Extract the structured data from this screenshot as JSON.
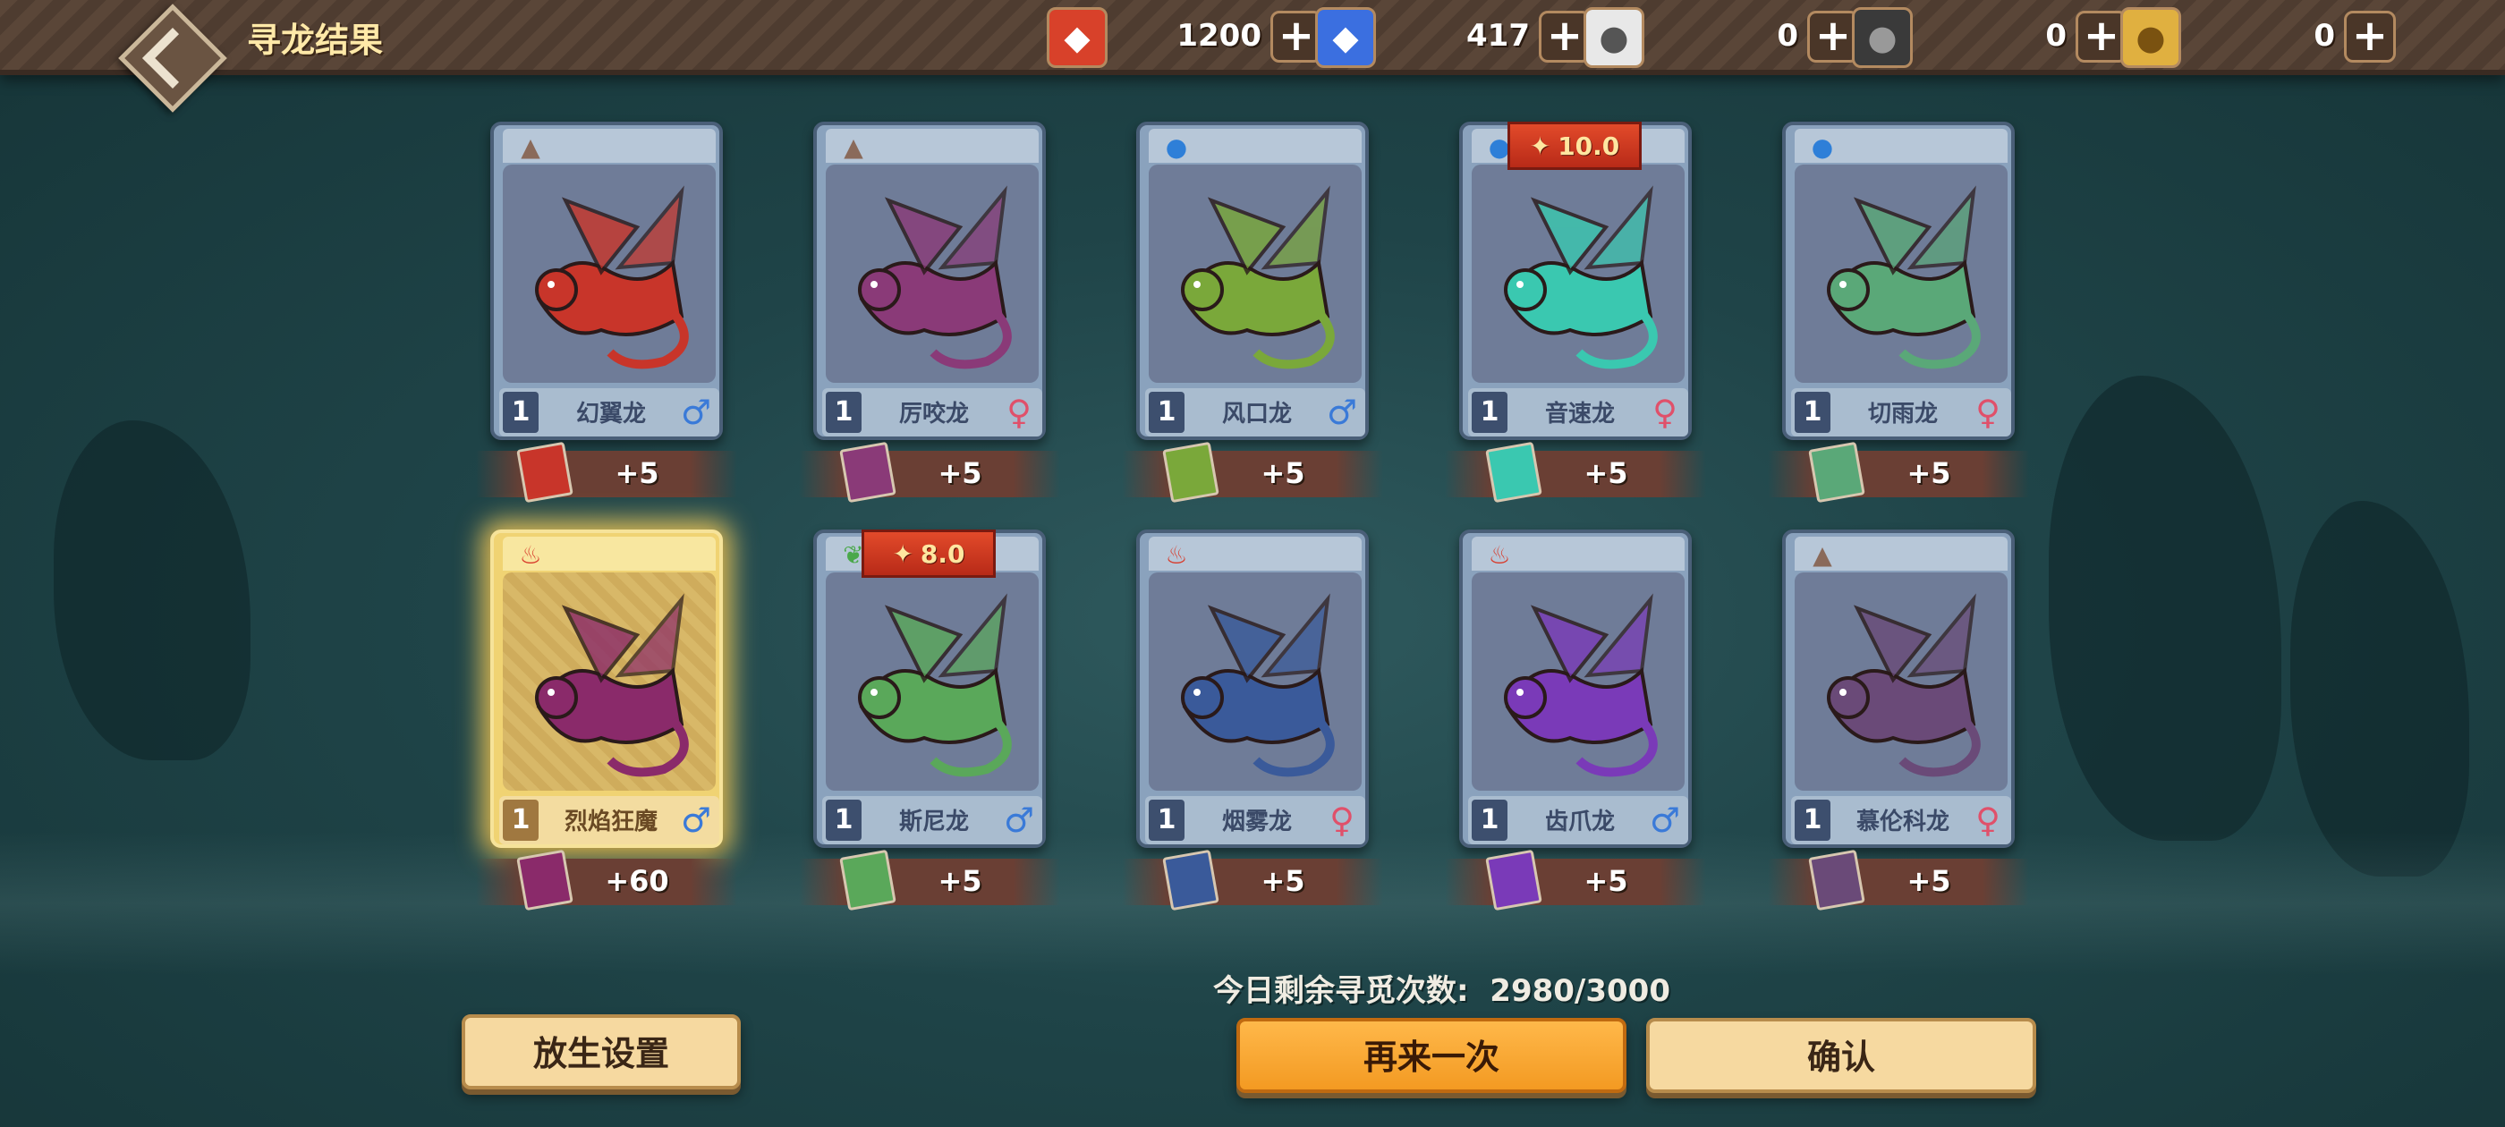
{
  "header": {
    "title": "寻龙结果",
    "resources": [
      {
        "icon": "red-gem-icon",
        "value": "1200",
        "color": "#d8412a"
      },
      {
        "icon": "blue-crystal-icon",
        "value": "417",
        "color": "#3b6fe0"
      },
      {
        "icon": "white-sheep-icon",
        "value": "0",
        "color": "#e8e8e8"
      },
      {
        "icon": "black-sheep-icon",
        "value": "0",
        "color": "#3a3a3a"
      },
      {
        "icon": "golden-sheep-icon",
        "value": "0",
        "color": "#e0b040"
      }
    ],
    "plus_label": "+"
  },
  "dragons": [
    {
      "name": "幻翼龙",
      "level": "1",
      "gender": "♂",
      "element": "earth",
      "reward": "+5",
      "badge": null,
      "color": "#c8352a",
      "highlight": false
    },
    {
      "name": "厉咬龙",
      "level": "1",
      "gender": "♀",
      "element": "earth",
      "reward": "+5",
      "badge": null,
      "color": "#8a3a78",
      "highlight": false
    },
    {
      "name": "风口龙",
      "level": "1",
      "gender": "♂",
      "element": "water",
      "reward": "+5",
      "badge": null,
      "color": "#7aa83a",
      "highlight": false
    },
    {
      "name": "音速龙",
      "level": "1",
      "gender": "♀",
      "element": "water",
      "reward": "+5",
      "badge": "10.0",
      "color": "#3ac8b0",
      "highlight": false
    },
    {
      "name": "切雨龙",
      "level": "1",
      "gender": "♀",
      "element": "water",
      "reward": "+5",
      "badge": null,
      "color": "#5aa878",
      "highlight": false
    },
    {
      "name": "烈焰狂魔",
      "level": "1",
      "gender": "♂",
      "element": "fire",
      "reward": "+60",
      "badge": null,
      "color": "#8a2a6a",
      "highlight": true
    },
    {
      "name": "斯尼龙",
      "level": "1",
      "gender": "♂",
      "element": "nature",
      "reward": "+5",
      "badge": "8.0",
      "color": "#5aa85a",
      "highlight": false
    },
    {
      "name": "烟雾龙",
      "level": "1",
      "gender": "♀",
      "element": "fire",
      "reward": "+5",
      "badge": null,
      "color": "#3a5a9a",
      "highlight": false
    },
    {
      "name": "齿爪龙",
      "level": "1",
      "gender": "♂",
      "element": "fire",
      "reward": "+5",
      "badge": null,
      "color": "#7a3ab8",
      "highlight": false
    },
    {
      "name": "慕伦科龙",
      "level": "1",
      "gender": "♀",
      "element": "earth",
      "reward": "+5",
      "badge": null,
      "color": "#6a4a78",
      "highlight": false
    }
  ],
  "footer": {
    "remaining_label": "今日剩余寻觅次数:",
    "remaining_value": "2980/3000",
    "release_button": "放生设置",
    "again_button": "再来一次",
    "confirm_button": "确认"
  }
}
